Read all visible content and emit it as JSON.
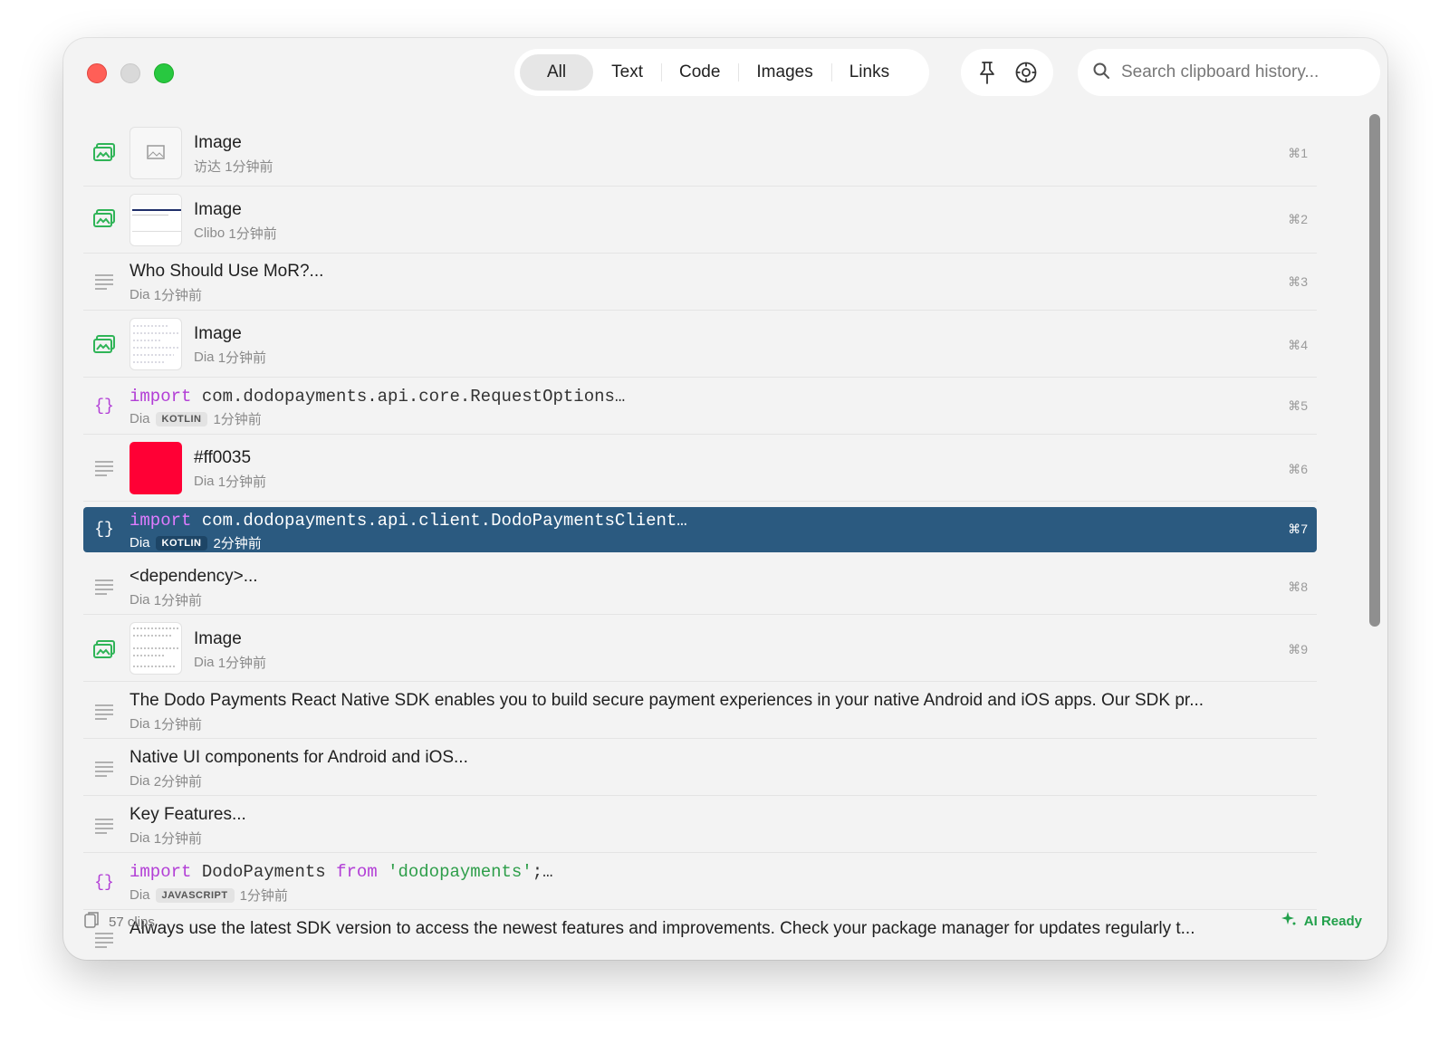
{
  "filters": {
    "tabs": [
      {
        "label": "All"
      },
      {
        "label": "Text"
      },
      {
        "label": "Code"
      },
      {
        "label": "Images"
      },
      {
        "label": "Links"
      }
    ],
    "active": "All"
  },
  "search": {
    "placeholder": "Search clipboard history..."
  },
  "items": [
    {
      "type": "image",
      "title": "Image",
      "source": "访达",
      "time": "1分钟前",
      "shortcut": "⌘1"
    },
    {
      "type": "image",
      "title": "Image",
      "source": "Clibo",
      "time": "1分钟前",
      "shortcut": "⌘2"
    },
    {
      "type": "text",
      "title": "Who Should Use MoR?...",
      "source": "Dia",
      "time": "1分钟前",
      "shortcut": "⌘3"
    },
    {
      "type": "image",
      "title": "Image",
      "source": "Dia",
      "time": "1分钟前",
      "shortcut": "⌘4"
    },
    {
      "type": "code",
      "keyword": "import",
      "rest": " com.dodopayments.api.core.RequestOptions…",
      "source": "Dia",
      "lang": "KOTLIN",
      "time": "1分钟前",
      "shortcut": "⌘5"
    },
    {
      "type": "color",
      "title": "#ff0035",
      "color": "#ff0035",
      "source": "Dia",
      "time": "1分钟前",
      "shortcut": "⌘6"
    },
    {
      "type": "code",
      "keyword": "import",
      "rest": " com.dodopayments.api.client.DodoPaymentsClient…",
      "source": "Dia",
      "lang": "KOTLIN",
      "time": "2分钟前",
      "shortcut": "⌘7",
      "selected": true
    },
    {
      "type": "text",
      "title": "<dependency>...",
      "source": "Dia",
      "time": "1分钟前",
      "shortcut": "⌘8"
    },
    {
      "type": "image",
      "title": "Image",
      "source": "Dia",
      "time": "1分钟前",
      "shortcut": "⌘9"
    },
    {
      "type": "text",
      "title": "The Dodo Payments React Native SDK enables you to build secure payment experiences in your native Android and iOS apps. Our SDK pr...",
      "source": "Dia",
      "time": "1分钟前"
    },
    {
      "type": "text",
      "title": "Native UI components for Android and iOS...",
      "source": "Dia",
      "time": "2分钟前"
    },
    {
      "type": "text",
      "title": "Key Features...",
      "source": "Dia",
      "time": "1分钟前"
    },
    {
      "type": "code",
      "js": [
        "import",
        " DodoPayments ",
        "from",
        " 'dodopayments'",
        ";…"
      ],
      "source": "Dia",
      "lang": "JAVASCRIPT",
      "time": "1分钟前"
    },
    {
      "type": "text",
      "title": "Always use the latest SDK version to access the newest features and improvements. Check your package manager for updates regularly t...",
      "source": "",
      "time": ""
    }
  ],
  "footer": {
    "clip_count": "57 clips",
    "ai_status": "AI Ready"
  },
  "colors": {
    "accent_selected": "#2b5a80",
    "image_icon": "#2fb457",
    "code_icon": "#b23ed6",
    "ai_ready": "#22a04b"
  }
}
